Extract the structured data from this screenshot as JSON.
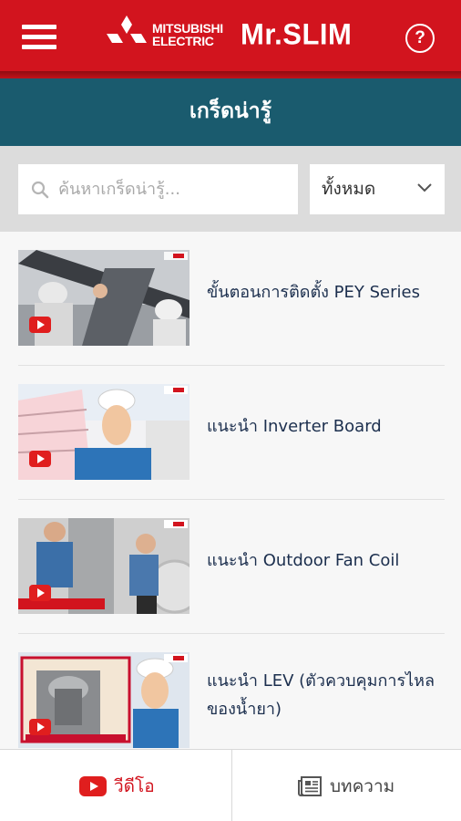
{
  "header": {
    "brand_line1": "MITSUBISHI",
    "brand_line2": "ELECTRIC",
    "product": "Mr.SLIM",
    "help_label": "?",
    "colors": {
      "primary": "#d2141e",
      "band": "#1a5b6e"
    }
  },
  "page": {
    "title": "เกร็ดน่ารู้"
  },
  "search": {
    "placeholder": "ค้นหาเกร็ดน่ารู้..."
  },
  "filter": {
    "selected": "ทั้งหมด"
  },
  "items": [
    {
      "title": "ขั้นตอนการติดตั้ง PEY Series",
      "icon": "play-badge-icon"
    },
    {
      "title": "แนะนำ Inverter Board",
      "icon": "play-badge-icon"
    },
    {
      "title": "แนะนำ Outdoor Fan Coil",
      "icon": "play-badge-icon"
    },
    {
      "title": "แนะนำ LEV (ตัวควบคุมการไหลของน้ำยา)",
      "icon": "play-badge-icon"
    }
  ],
  "tabs": [
    {
      "label": "วีดีโอ",
      "icon": "youtube-icon",
      "active": true
    },
    {
      "label": "บทความ",
      "icon": "newspaper-icon",
      "active": false
    }
  ]
}
